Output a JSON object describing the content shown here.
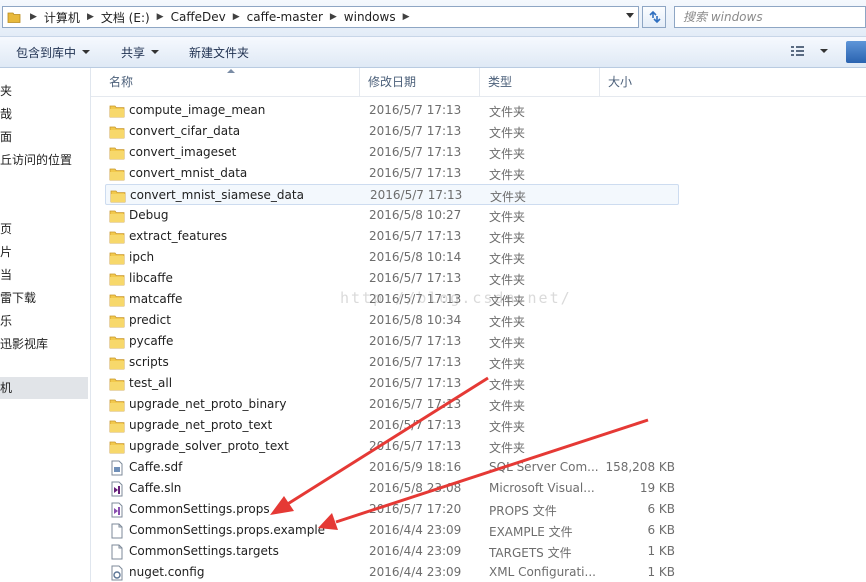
{
  "address_bar": {
    "breadcrumbs": [
      "计算机",
      "文档 (E:)",
      "CaffeDev",
      "caffe-master",
      "windows"
    ]
  },
  "search": {
    "placeholder": "搜索 windows"
  },
  "toolbar": {
    "include_in_library": "包含到库中",
    "share": "共享",
    "new_folder": "新建文件夹"
  },
  "nav_pane": {
    "items": [
      "夹",
      "哉",
      "面",
      "丘访问的位置",
      "页",
      "片",
      "当",
      "雷下载",
      "乐",
      "迅影视库",
      "机"
    ]
  },
  "columns": {
    "name": "名称",
    "date": "修改日期",
    "type": "类型",
    "size": "大小"
  },
  "files": [
    {
      "name": "compute_image_mean",
      "date": "2016/5/7 17:13",
      "type": "文件夹",
      "size": "",
      "icon": "folder-icon"
    },
    {
      "name": "convert_cifar_data",
      "date": "2016/5/7 17:13",
      "type": "文件夹",
      "size": "",
      "icon": "folder-icon"
    },
    {
      "name": "convert_imageset",
      "date": "2016/5/7 17:13",
      "type": "文件夹",
      "size": "",
      "icon": "folder-icon"
    },
    {
      "name": "convert_mnist_data",
      "date": "2016/5/7 17:13",
      "type": "文件夹",
      "size": "",
      "icon": "folder-icon"
    },
    {
      "name": "convert_mnist_siamese_data",
      "date": "2016/5/7 17:13",
      "type": "文件夹",
      "size": "",
      "icon": "folder-icon"
    },
    {
      "name": "Debug",
      "date": "2016/5/8 10:27",
      "type": "文件夹",
      "size": "",
      "icon": "folder-icon"
    },
    {
      "name": "extract_features",
      "date": "2016/5/7 17:13",
      "type": "文件夹",
      "size": "",
      "icon": "folder-icon"
    },
    {
      "name": "ipch",
      "date": "2016/5/8 10:14",
      "type": "文件夹",
      "size": "",
      "icon": "folder-icon"
    },
    {
      "name": "libcaffe",
      "date": "2016/5/7 17:13",
      "type": "文件夹",
      "size": "",
      "icon": "folder-icon"
    },
    {
      "name": "matcaffe",
      "date": "2016/5/7 17:13",
      "type": "文件夹",
      "size": "",
      "icon": "folder-icon"
    },
    {
      "name": "predict",
      "date": "2016/5/8 10:34",
      "type": "文件夹",
      "size": "",
      "icon": "folder-icon"
    },
    {
      "name": "pycaffe",
      "date": "2016/5/7 17:13",
      "type": "文件夹",
      "size": "",
      "icon": "folder-icon"
    },
    {
      "name": "scripts",
      "date": "2016/5/7 17:13",
      "type": "文件夹",
      "size": "",
      "icon": "folder-icon"
    },
    {
      "name": "test_all",
      "date": "2016/5/7 17:13",
      "type": "文件夹",
      "size": "",
      "icon": "folder-icon"
    },
    {
      "name": "upgrade_net_proto_binary",
      "date": "2016/5/7 17:13",
      "type": "文件夹",
      "size": "",
      "icon": "folder-icon"
    },
    {
      "name": "upgrade_net_proto_text",
      "date": "2016/5/7 17:13",
      "type": "文件夹",
      "size": "",
      "icon": "folder-icon"
    },
    {
      "name": "upgrade_solver_proto_text",
      "date": "2016/5/7 17:13",
      "type": "文件夹",
      "size": "",
      "icon": "folder-icon"
    },
    {
      "name": "Caffe.sdf",
      "date": "2016/5/9 18:16",
      "type": "SQL Server Com...",
      "size": "158,208 KB",
      "icon": "sdf-file-icon"
    },
    {
      "name": "Caffe.sln",
      "date": "2016/5/8 23:08",
      "type": "Microsoft Visual...",
      "size": "19 KB",
      "icon": "sln-file-icon"
    },
    {
      "name": "CommonSettings.props",
      "date": "2016/5/7 17:20",
      "type": "PROPS 文件",
      "size": "6 KB",
      "icon": "props-file-icon"
    },
    {
      "name": "CommonSettings.props.example",
      "date": "2016/4/4 23:09",
      "type": "EXAMPLE 文件",
      "size": "6 KB",
      "icon": "file-icon"
    },
    {
      "name": "CommonSettings.targets",
      "date": "2016/4/4 23:09",
      "type": "TARGETS 文件",
      "size": "1 KB",
      "icon": "file-icon"
    },
    {
      "name": "nuget.config",
      "date": "2016/4/4 23:09",
      "type": "XML Configurati...",
      "size": "1 KB",
      "icon": "config-file-icon"
    }
  ],
  "watermark": "http://blog.csdn.net/",
  "colors": {
    "folder": "#f2c94c",
    "annotation_arrow": "#e53935",
    "selection": "#cddcf0"
  }
}
